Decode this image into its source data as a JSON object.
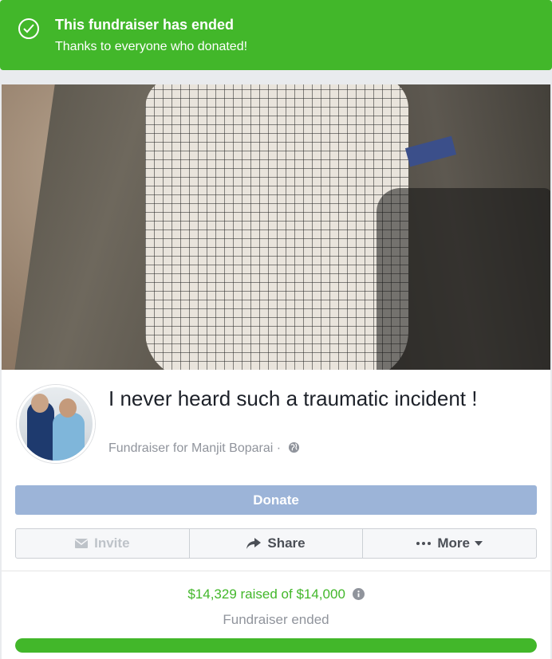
{
  "banner": {
    "title": "This fundraiser has ended",
    "subtitle": "Thanks to everyone who donated!",
    "icon": "check-circle-icon",
    "color": "#42b72a"
  },
  "fundraiser": {
    "title": "I never heard such a traumatic incident !",
    "byline": "Fundraiser for Manjit Boparai ·",
    "privacy_icon": "globe-icon"
  },
  "actions": {
    "donate_label": "Donate",
    "invite_label": "Invite",
    "share_label": "Share",
    "more_label": "More"
  },
  "progress": {
    "raised_text": "$14,329 raised of $14,000",
    "status_text": "Fundraiser ended",
    "fraction": 1.0,
    "color": "#42b72a"
  }
}
